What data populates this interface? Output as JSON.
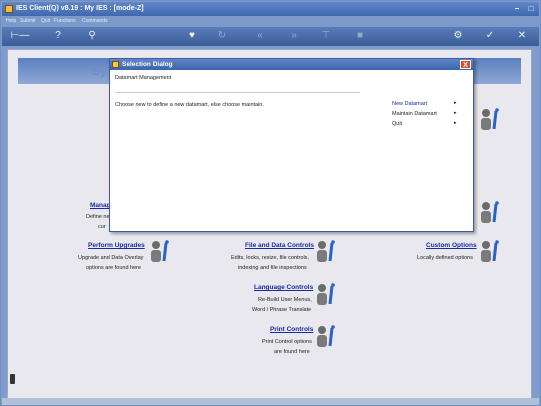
{
  "window": {
    "title": "IES Client(Q) v8.19 : My IES : [mode-Z]"
  },
  "menubar": [
    "Help",
    "Submit",
    "Quit",
    "Functions",
    "Commands"
  ],
  "banner": {
    "text": "Sy"
  },
  "sections": [
    {
      "title": "Manage",
      "lines": [
        "Define ne",
        "cur"
      ]
    },
    {
      "title": "Perform Upgrades",
      "lines": [
        "Upgrade and Data Overlay",
        "options are found here"
      ]
    },
    {
      "title": "File and Data Controls",
      "lines": [
        "Edits, locks, resize, file controls,",
        "indexing and file inspections"
      ]
    },
    {
      "title": "Custom Options",
      "lines": [
        "Locally defined options"
      ]
    },
    {
      "title": "Language Controls",
      "lines": [
        "Re-Build User Menus,",
        "Word / Phrase Translate"
      ]
    },
    {
      "title": "Print Controls",
      "lines": [
        "Print Control options",
        "are found here"
      ]
    }
  ],
  "dialog": {
    "title": "Selection Dialog",
    "subtitle": "Datamart Management",
    "prompt": "Choose new to define a new datamart, else choose maintain.",
    "close_label": "X",
    "options": [
      {
        "label": "New Datamart",
        "selected": true
      },
      {
        "label": "Maintain Datamart",
        "selected": false
      },
      {
        "label": "Quit",
        "selected": false
      }
    ],
    "arrow": "▸"
  }
}
